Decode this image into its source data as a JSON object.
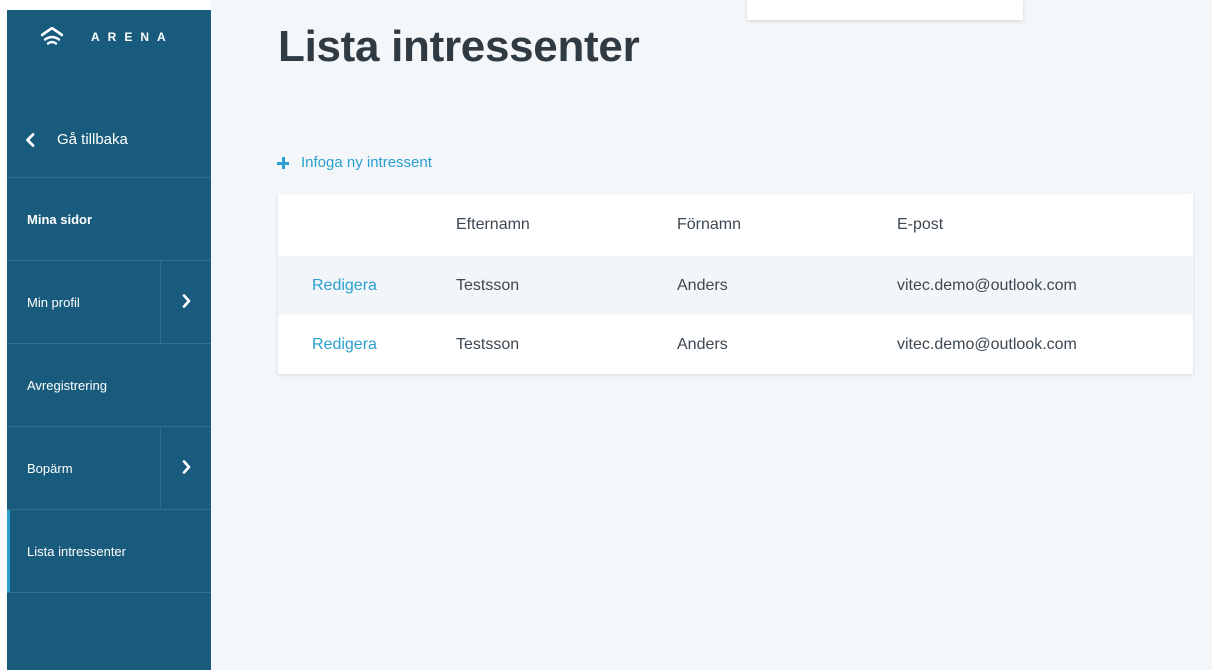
{
  "app": {
    "logo_text": "ARENA"
  },
  "sidebar": {
    "back_label": "Gå tillbaka",
    "items": [
      {
        "label": "Mina sidor",
        "has_arrow": false
      },
      {
        "label": "Min profil",
        "has_arrow": true
      },
      {
        "label": "Avregistrering",
        "has_arrow": false
      },
      {
        "label": "Bopärm",
        "has_arrow": true
      },
      {
        "label": "Lista intressenter",
        "has_arrow": false,
        "active": true
      }
    ]
  },
  "main": {
    "title": "Lista intressenter",
    "add_label": "Infoga ny intressent",
    "table": {
      "headers": [
        "",
        "Efternamn",
        "Förnamn",
        "E-post"
      ],
      "rows": [
        {
          "action": "Redigera",
          "efternamn": "Testsson",
          "fornamn": "Anders",
          "epost": "vitec.demo@outlook.com"
        },
        {
          "action": "Redigera",
          "efternamn": "Testsson",
          "fornamn": "Anders",
          "epost": "vitec.demo@outlook.com"
        }
      ]
    }
  },
  "colors": {
    "sidebar_bg": "#195b7c",
    "accent": "#2a9fd0",
    "main_bg": "#f4f7f9",
    "title": "#2f3a42"
  },
  "icons": {
    "logo": "wifi-house-icon",
    "back": "chevron-left-icon",
    "expand": "chevron-right-icon",
    "add": "plus-icon"
  }
}
